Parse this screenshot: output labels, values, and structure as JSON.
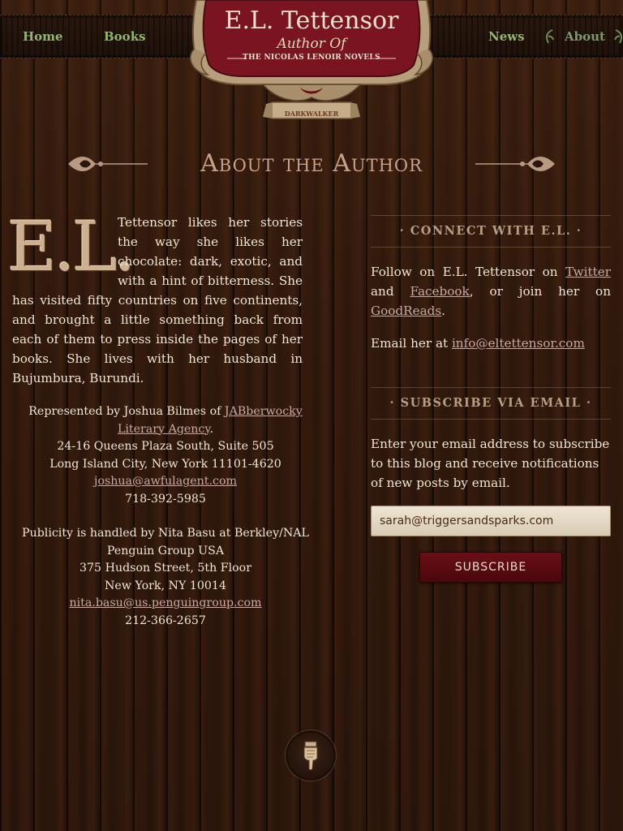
{
  "nav": {
    "home": "Home",
    "books": "Books",
    "news": "News",
    "about": "About"
  },
  "emblem": {
    "title": "E.L. Tettensor",
    "subtitle": "Author Of",
    "series": "THE NICOLAS LENOIR NOVELS",
    "ribbon": "DARKWALKER"
  },
  "page": {
    "heading": "About the Author"
  },
  "bio": {
    "dropcap": "E.L.",
    "text": "Tettensor likes her stories the way she likes her chocolate: dark, exotic, and with a hint of bitterness. She has visited fifty countries on five continents, and brought a little something back from each of them to press inside the pages of her books. She lives with her husband in Bujumbura, Burundi."
  },
  "agent": {
    "intro": "Represented by Joshua Bilmes of ",
    "agency_link": "JABberwocky Literary Agency",
    "period": ".",
    "address1": "24-16 Queens Plaza South, Suite 505",
    "address2": "Long Island City, New York 11101-4620",
    "email": "joshua@awfulagent.com",
    "phone": "718-392-5985"
  },
  "publicity": {
    "intro": "Publicity is handled by Nita Basu at Berkley/NAL Penguin Group USA",
    "address1": "375 Hudson Street, 5th Floor",
    "address2": "New York, NY 10014",
    "email": "nita.basu@us.penguingroup.com",
    "phone": "212-366-2657"
  },
  "sidebar": {
    "connect_title": "· CONNECT WITH E.L. ·",
    "follow_prefix": "Follow on E.L. Tettensor on ",
    "twitter": "Twitter",
    "and": " and ",
    "facebook": "Facebook",
    "or_join": ", or join her on ",
    "goodreads": "GoodReads",
    "period": ".",
    "email_prefix": "Email her at ",
    "email": "info@eltettensor.com",
    "subscribe_title": "· SUBSCRIBE VIA EMAIL ·",
    "subscribe_text": "Enter your email address to subscribe to this blog and receive notifications of new posts by email.",
    "email_value": "sarah@triggersandsparks.com",
    "subscribe_button": "SUBSCRIBE"
  },
  "colors": {
    "nav_link": "#8fb86a",
    "heading": "#c9a28a",
    "link": "#c9a8a3",
    "button": "#5a0a12"
  },
  "icons": {
    "back_to_top": "pointing-hand-icon",
    "nav_ornament": "leaf-ornament-icon"
  }
}
